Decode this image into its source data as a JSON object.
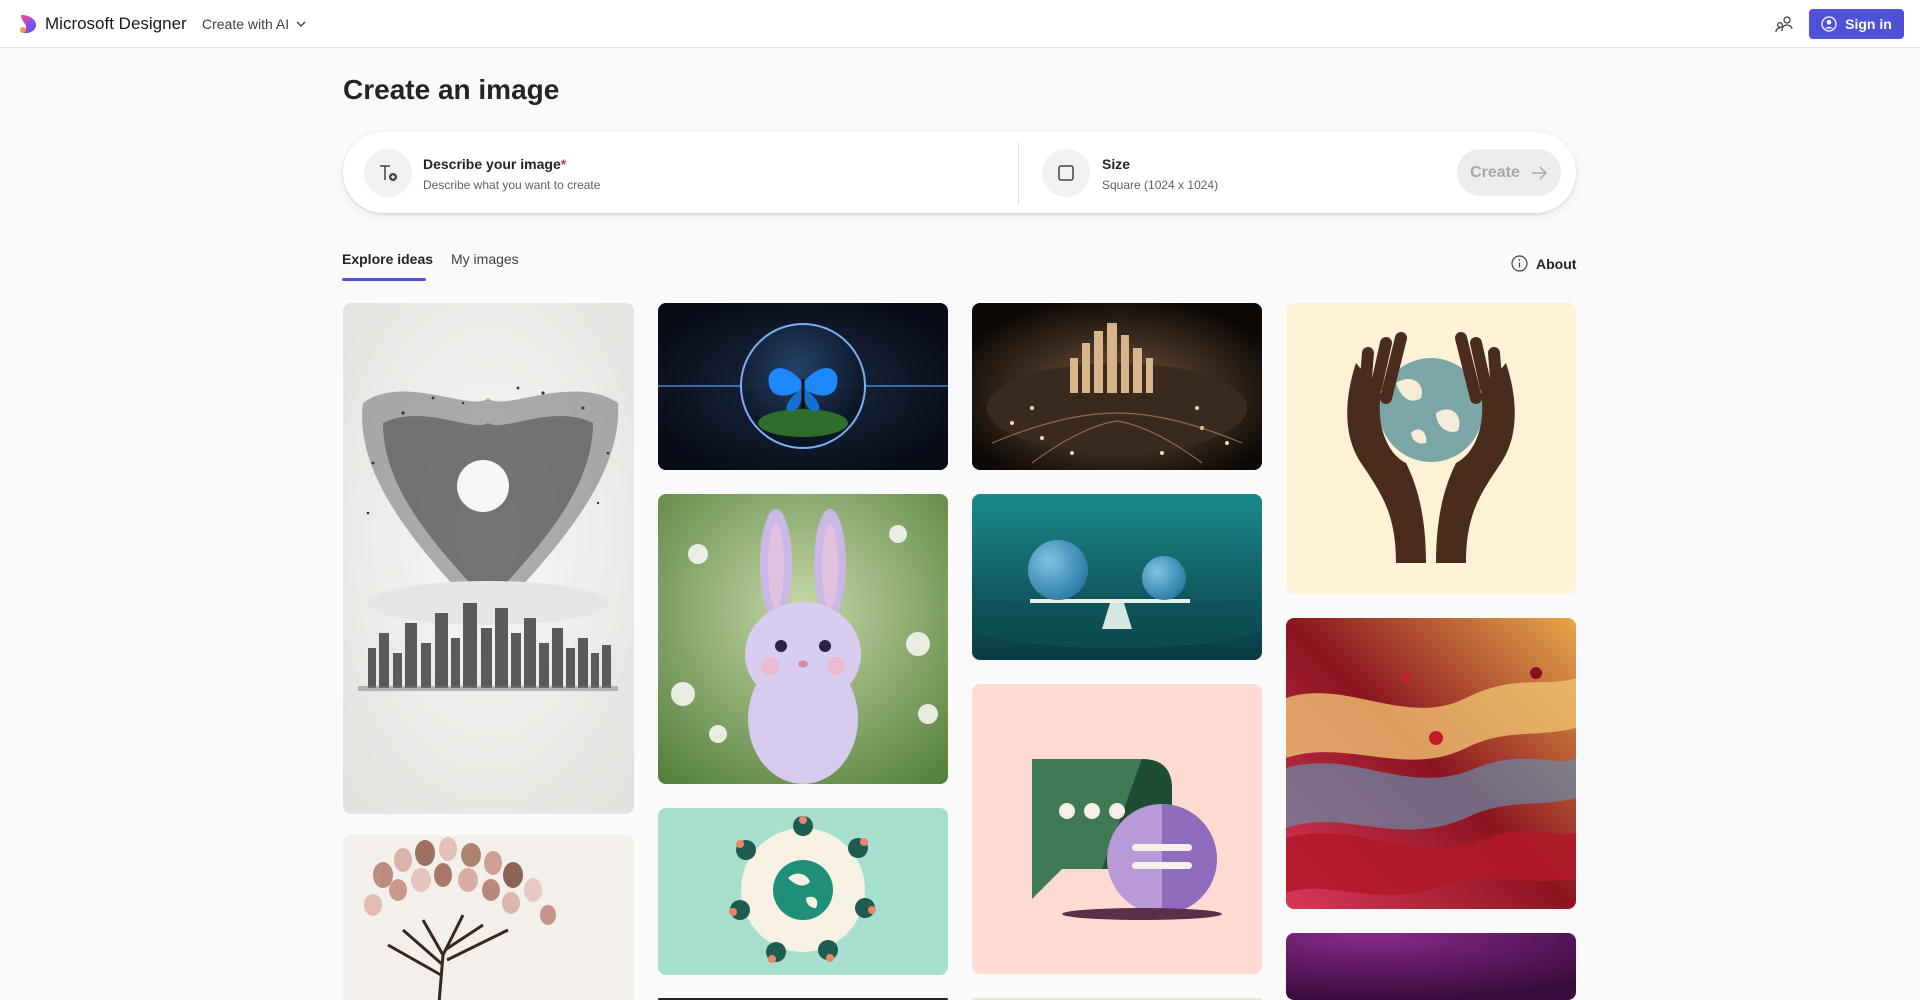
{
  "header": {
    "brand": "Microsoft Designer",
    "menu_label": "Create with AI",
    "signin_label": "Sign in",
    "icons": [
      "designer-logo-icon",
      "chevron-down-icon",
      "share-icon",
      "person-icon"
    ]
  },
  "page": {
    "title": "Create an image"
  },
  "prompt": {
    "describe_label": "Describe your image",
    "required_mark": "*",
    "describe_hint": "Describe what you want to create",
    "size_label": "Size",
    "size_value": "Square (1024 x 1024)",
    "create_label": "Create"
  },
  "tabs": [
    {
      "label": "Explore ideas",
      "active": true
    },
    {
      "label": "My images",
      "active": false
    }
  ],
  "about_label": "About",
  "gallery": [
    "birds-heart-city-image",
    "butterfly-orb-image",
    "circuit-city-image",
    "hands-globe-image",
    "purple-bunny-image",
    "balance-spheres-image",
    "liquid-metal-image",
    "chat-bubbles-image",
    "people-globe-image",
    "tree-fingerprints-image",
    "purple-gradient-image"
  ],
  "colors": {
    "accent": "#4f52d6",
    "background": "#fafafa"
  }
}
